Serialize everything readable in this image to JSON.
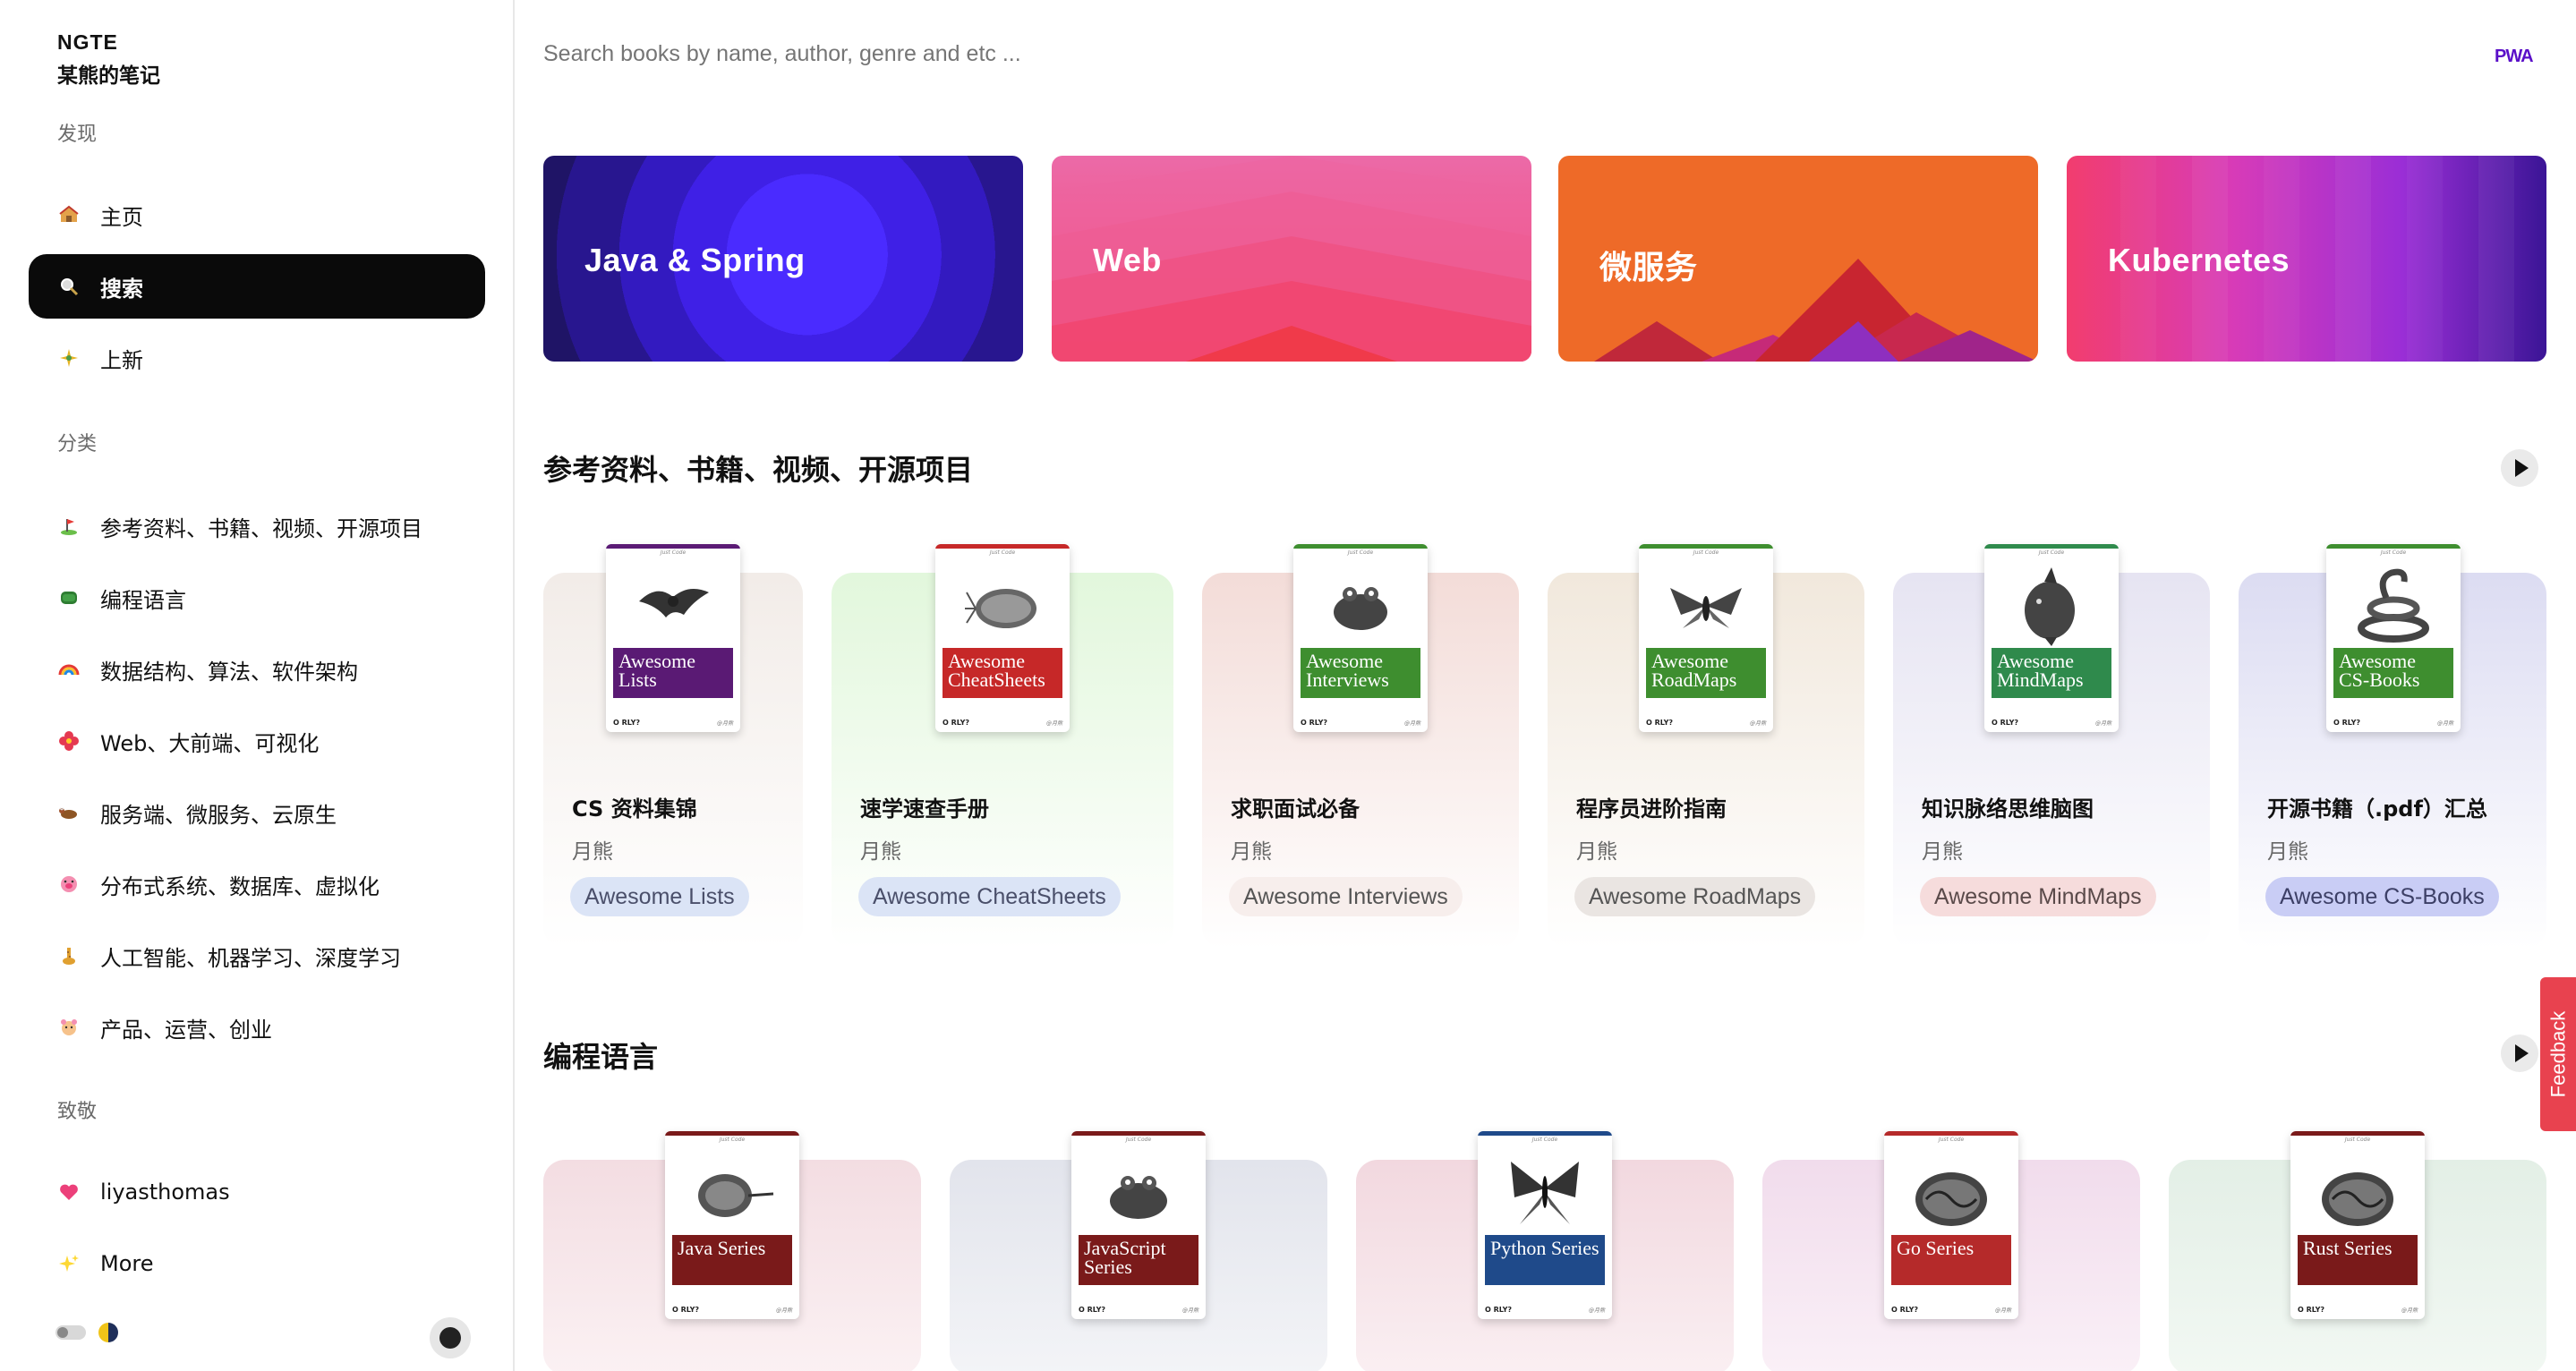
{
  "sidebar": {
    "brand": "NGTE",
    "subtitle": "某熊的笔记",
    "sections": {
      "discover": "发现",
      "categories": "分类",
      "tribute": "致敬"
    },
    "discover_items": [
      {
        "label": "主页",
        "icon": "house-icon"
      },
      {
        "label": "搜索",
        "icon": "magnifier-icon"
      },
      {
        "label": "上新",
        "icon": "sparkle-icon"
      }
    ],
    "category_items": [
      {
        "label": "参考资料、书籍、视频、开源项目",
        "icon": "golf-icon"
      },
      {
        "label": "编程语言",
        "icon": "database-icon"
      },
      {
        "label": "数据结构、算法、软件架构",
        "icon": "rainbow-icon"
      },
      {
        "label": "Web、大前端、可视化",
        "icon": "flower-icon"
      },
      {
        "label": "服务端、微服务、云原生",
        "icon": "ox-icon"
      },
      {
        "label": "分布式系统、数据库、虚拟化",
        "icon": "pig-icon"
      },
      {
        "label": "人工智能、机器学习、深度学习",
        "icon": "giraffe-icon"
      },
      {
        "label": "产品、运营、创业",
        "icon": "hamster-icon"
      }
    ],
    "tribute_items": [
      {
        "label": "liyasthomas",
        "icon": "heart-icon"
      },
      {
        "label": "More",
        "icon": "sparkles-icon"
      }
    ]
  },
  "search": {
    "placeholder": "Search books by name, author, genre and etc ..."
  },
  "pwa_badge": "PWA",
  "banners": [
    {
      "label": "Java & Spring"
    },
    {
      "label": "Web"
    },
    {
      "label": "微服务"
    },
    {
      "label": "Kubernetes"
    }
  ],
  "section1": {
    "title": "参考资料、书籍、视频、开源项目",
    "cards": [
      {
        "title": "CS 资料集锦",
        "author": "月熊",
        "chip": "Awesome Lists",
        "book_title": "Awesome Lists",
        "band_color": "#5a1a74",
        "bg": "#f2ece8",
        "chip_bg": "#dbe4f6",
        "chip_color": "#4a4f6a"
      },
      {
        "title": "速学速查手册",
        "author": "月熊",
        "chip": "Awesome CheatSheets",
        "book_title": "Awesome CheatSheets",
        "band_color": "#c62828",
        "bg": "#e6f7e2",
        "chip_bg": "#dbe4f6",
        "chip_color": "#4a4f6a"
      },
      {
        "title": "求职面试必备",
        "author": "月熊",
        "chip": "Awesome Interviews",
        "book_title": "Awesome Interviews",
        "band_color": "#3e8e2f",
        "bg": "#f3dcd8",
        "chip_bg": "#f7eeec",
        "chip_color": "#555"
      },
      {
        "title": "程序员进阶指南",
        "author": "月熊",
        "chip": "Awesome RoadMaps",
        "book_title": "Awesome RoadMaps",
        "band_color": "#3e8e2f",
        "bg": "#f1e8dc",
        "chip_bg": "#eae5e2",
        "chip_color": "#555"
      },
      {
        "title": "知识脉络思维脑图",
        "author": "月熊",
        "chip": "Awesome MindMaps",
        "book_title": "Awesome MindMaps",
        "band_color": "#2f8a4c",
        "bg": "#e6e4f2",
        "chip_bg": "#f6dcdc",
        "chip_color": "#5a4a4a"
      },
      {
        "title": "开源书籍（.pdf）汇总",
        "author": "月熊",
        "chip": "Awesome CS-Books",
        "book_title": "Awesome CS-Books",
        "band_color": "#3e8e2f",
        "bg": "#dcdcf2",
        "chip_bg": "#c9cdf5",
        "chip_color": "#3c3f66"
      }
    ]
  },
  "section2": {
    "title": "编程语言",
    "cards": [
      {
        "book_title": "Java Series",
        "band_color": "#7a1a1a",
        "bg": "#f3dde2",
        "topbar": "#7a1a1a"
      },
      {
        "book_title": "JavaScript Series",
        "band_color": "#7a1a1a",
        "bg": "#e2e4ec",
        "topbar": "#7a1a1a"
      },
      {
        "book_title": "Python Series",
        "band_color": "#1f4a8a",
        "bg": "#f2d8df",
        "topbar": "#1f4a8a"
      },
      {
        "book_title": "Go Series",
        "band_color": "#b52a2a",
        "bg": "#f1dcec",
        "topbar": "#b52a2a"
      },
      {
        "book_title": "Rust Series",
        "band_color": "#7a1a1a",
        "bg": "#e3efe6",
        "topbar": "#7a1a1a"
      }
    ]
  },
  "book_tagline": "Just Code",
  "book_publisher": "O RLY?",
  "book_author": "@月熊",
  "feedback": "Feedback"
}
